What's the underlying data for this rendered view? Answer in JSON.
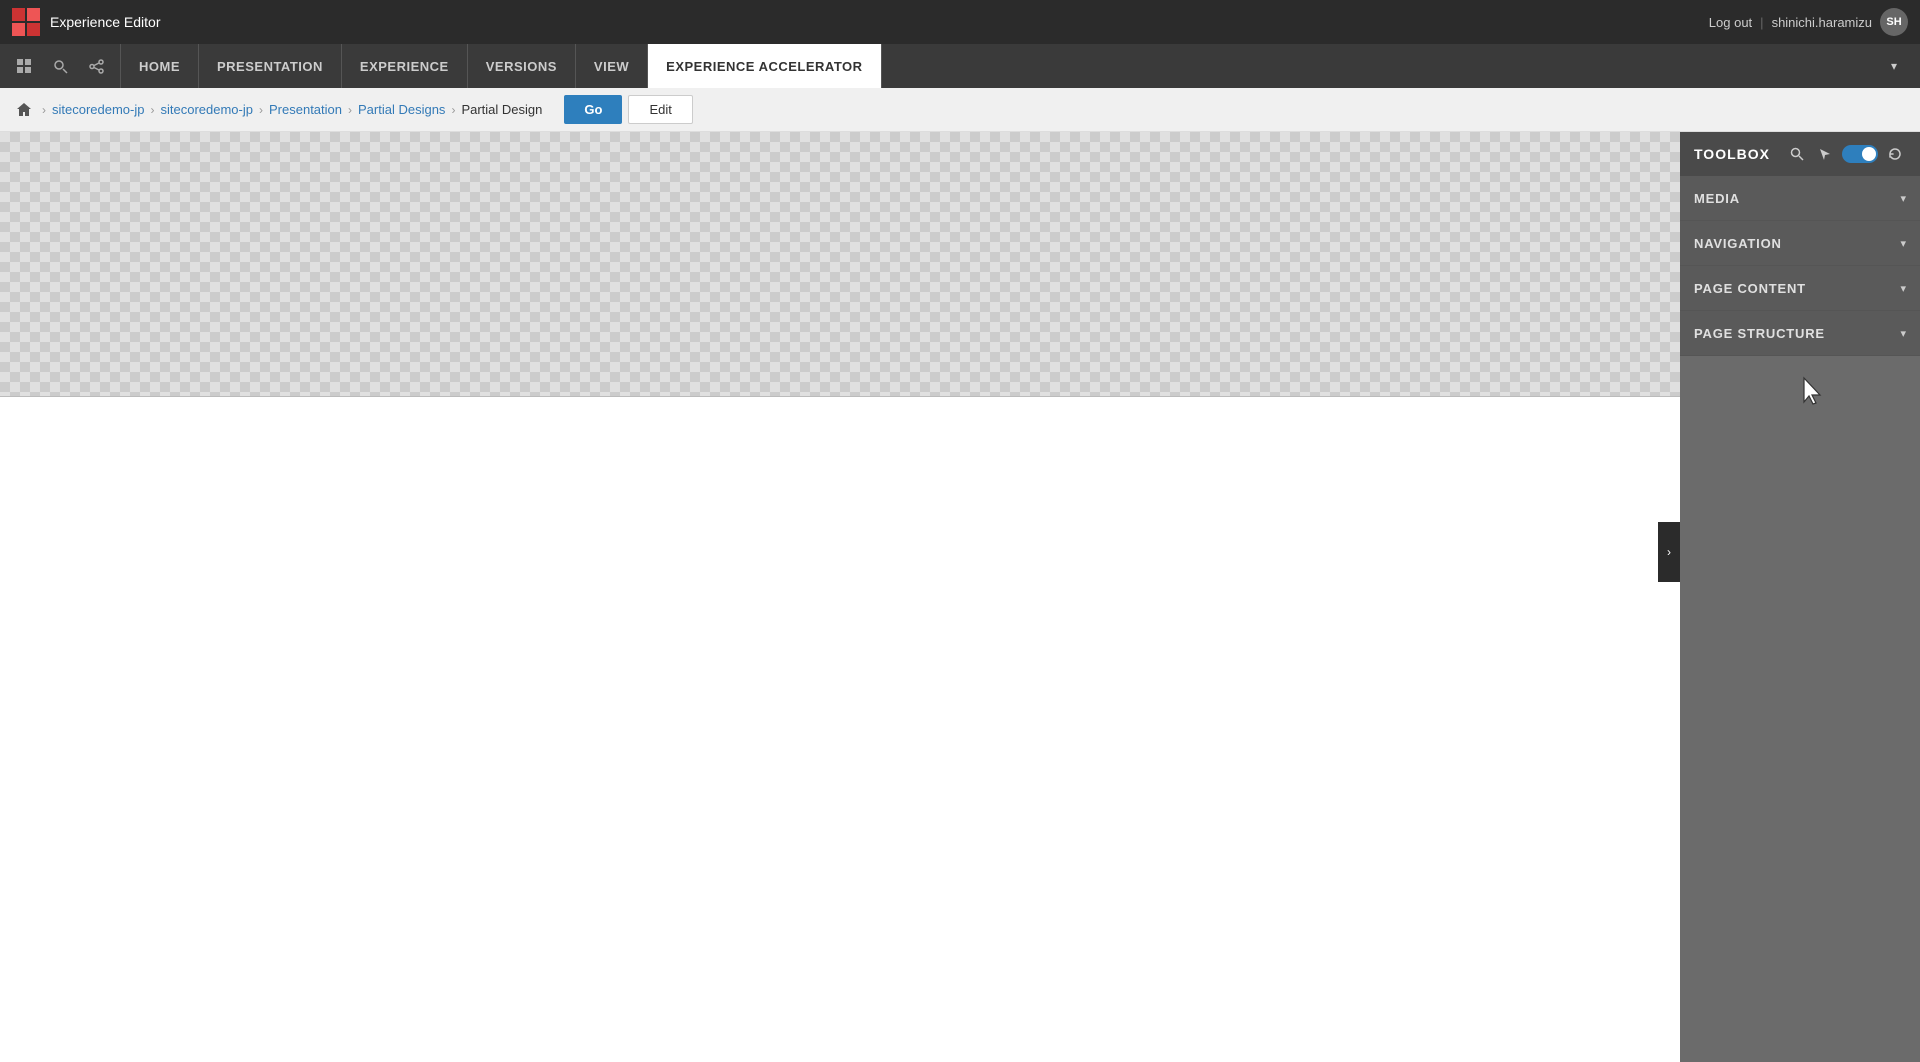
{
  "topBar": {
    "appTitle": "Experience Editor",
    "logoutLabel": "Log out",
    "separatorText": "|",
    "username": "shinichi.haramizu",
    "avatarText": "SH"
  },
  "navBar": {
    "tabs": [
      {
        "id": "home",
        "label": "HOME",
        "active": false
      },
      {
        "id": "presentation",
        "label": "PRESENTATION",
        "active": false
      },
      {
        "id": "experience",
        "label": "EXPERIENCE",
        "active": false
      },
      {
        "id": "versions",
        "label": "VERSIONS",
        "active": false
      },
      {
        "id": "view",
        "label": "VIEW",
        "active": false
      },
      {
        "id": "experience-accelerator",
        "label": "EXPERIENCE ACCELERATOR",
        "active": true
      }
    ]
  },
  "breadcrumb": {
    "items": [
      {
        "label": "sitecoredemo-jp",
        "isCurrent": false
      },
      {
        "label": "sitecoredemo-jp",
        "isCurrent": false
      },
      {
        "label": "Presentation",
        "isCurrent": false
      },
      {
        "label": "Partial Designs",
        "isCurrent": false
      },
      {
        "label": "Partial Design",
        "isCurrent": true
      }
    ],
    "goButton": "Go",
    "editButton": "Edit"
  },
  "toolbox": {
    "title": "TOOLBOX",
    "sections": [
      {
        "id": "media",
        "label": "MEDIA"
      },
      {
        "id": "navigation",
        "label": "NAVIGATION"
      },
      {
        "id": "page-content",
        "label": "PAGE CONTENT"
      },
      {
        "id": "page-structure",
        "label": "PAGE STRUCTURE"
      }
    ]
  },
  "icons": {
    "search": "🔍",
    "share": "⤢",
    "home": "⌂",
    "chevronRight": "›",
    "chevronDown": "▾",
    "chevronLeft": "‹",
    "cursor": "↖",
    "refresh": "↻"
  }
}
